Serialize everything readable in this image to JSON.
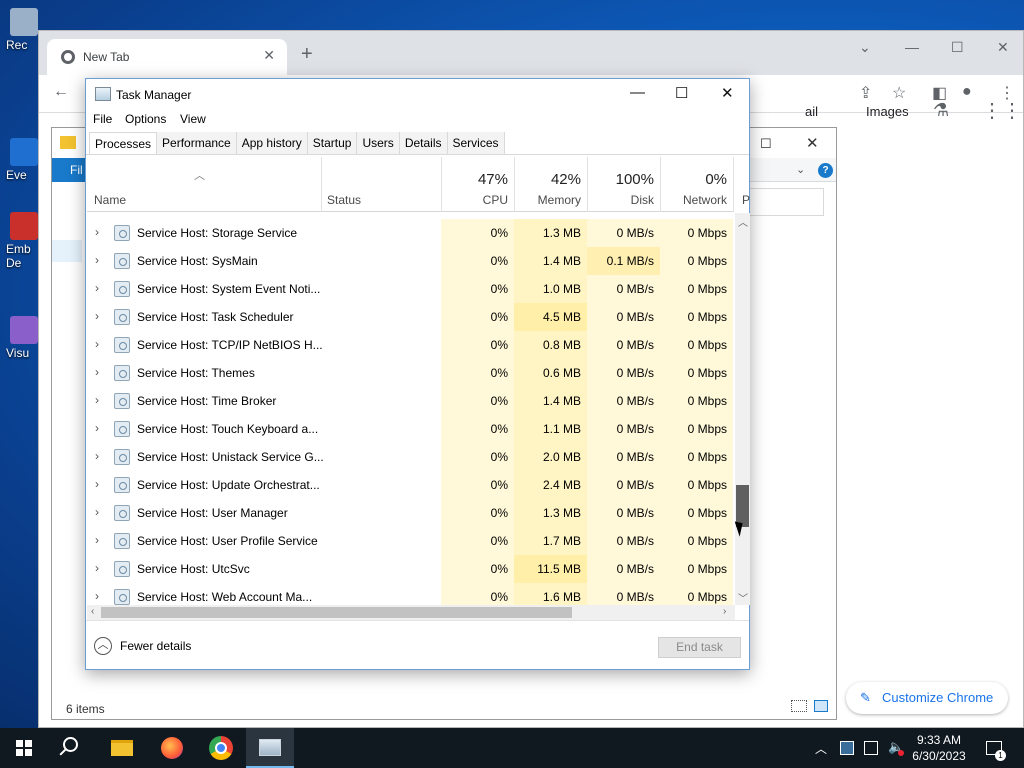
{
  "desktop": {
    "icons": [
      {
        "label": "Rec",
        "color": "#9ab0c8"
      },
      {
        "label": "Eve",
        "color": "#1f6fd1"
      },
      {
        "label": "Emb",
        "color": "#c9302c"
      },
      {
        "label": "De",
        "color": "#c9302c"
      },
      {
        "label": "Visu",
        "color": "#8b5fc9"
      }
    ]
  },
  "chrome": {
    "tab_title": "New Tab",
    "tab_close": "✕",
    "new_tab": "+",
    "gmail_fragment": "ail",
    "images_link": "Images",
    "customize_label": "Customize Chrome"
  },
  "explorer": {
    "ribbon_file": "Fil",
    "status": "6 items",
    "help": "?"
  },
  "task_manager": {
    "title": "Task Manager",
    "menu": [
      "File",
      "Options",
      "View"
    ],
    "tabs": [
      "Processes",
      "Performance",
      "App history",
      "Startup",
      "Users",
      "Details",
      "Services"
    ],
    "active_tab": "Processes",
    "columns": {
      "name": "Name",
      "status": "Status",
      "cpu": {
        "pct": "47%",
        "label": "CPU"
      },
      "memory": {
        "pct": "42%",
        "label": "Memory"
      },
      "disk": {
        "pct": "100%",
        "label": "Disk"
      },
      "network": {
        "pct": "0%",
        "label": "Network"
      },
      "next_partial": "P"
    },
    "rows": [
      {
        "name": "Service Host: Storage Service",
        "cpu": "0%",
        "memory": "1.3 MB",
        "disk": "0 MB/s",
        "network": "0 Mbps"
      },
      {
        "name": "Service Host: SysMain",
        "cpu": "0%",
        "memory": "1.4 MB",
        "disk": "0.1 MB/s",
        "network": "0 Mbps"
      },
      {
        "name": "Service Host: System Event Noti...",
        "cpu": "0%",
        "memory": "1.0 MB",
        "disk": "0 MB/s",
        "network": "0 Mbps"
      },
      {
        "name": "Service Host: Task Scheduler",
        "cpu": "0%",
        "memory": "4.5 MB",
        "disk": "0 MB/s",
        "network": "0 Mbps"
      },
      {
        "name": "Service Host: TCP/IP NetBIOS H...",
        "cpu": "0%",
        "memory": "0.8 MB",
        "disk": "0 MB/s",
        "network": "0 Mbps"
      },
      {
        "name": "Service Host: Themes",
        "cpu": "0%",
        "memory": "0.6 MB",
        "disk": "0 MB/s",
        "network": "0 Mbps"
      },
      {
        "name": "Service Host: Time Broker",
        "cpu": "0%",
        "memory": "1.4 MB",
        "disk": "0 MB/s",
        "network": "0 Mbps"
      },
      {
        "name": "Service Host: Touch Keyboard a...",
        "cpu": "0%",
        "memory": "1.1 MB",
        "disk": "0 MB/s",
        "network": "0 Mbps"
      },
      {
        "name": "Service Host: Unistack Service G...",
        "cpu": "0%",
        "memory": "2.0 MB",
        "disk": "0 MB/s",
        "network": "0 Mbps"
      },
      {
        "name": "Service Host: Update Orchestrat...",
        "cpu": "0%",
        "memory": "2.4 MB",
        "disk": "0 MB/s",
        "network": "0 Mbps"
      },
      {
        "name": "Service Host: User Manager",
        "cpu": "0%",
        "memory": "1.3 MB",
        "disk": "0 MB/s",
        "network": "0 Mbps"
      },
      {
        "name": "Service Host: User Profile Service",
        "cpu": "0%",
        "memory": "1.7 MB",
        "disk": "0 MB/s",
        "network": "0 Mbps"
      },
      {
        "name": "Service Host: UtcSvc",
        "cpu": "0%",
        "memory": "11.5 MB",
        "disk": "0 MB/s",
        "network": "0 Mbps"
      },
      {
        "name": "Service Host: Web Account Ma...",
        "cpu": "0%",
        "memory": "1.6 MB",
        "disk": "0 MB/s",
        "network": "0 Mbps"
      }
    ],
    "fewer_details": "Fewer details",
    "end_task": "End task"
  },
  "taskbar": {
    "time": "9:33 AM",
    "date": "6/30/2023",
    "notification_count": "1"
  }
}
